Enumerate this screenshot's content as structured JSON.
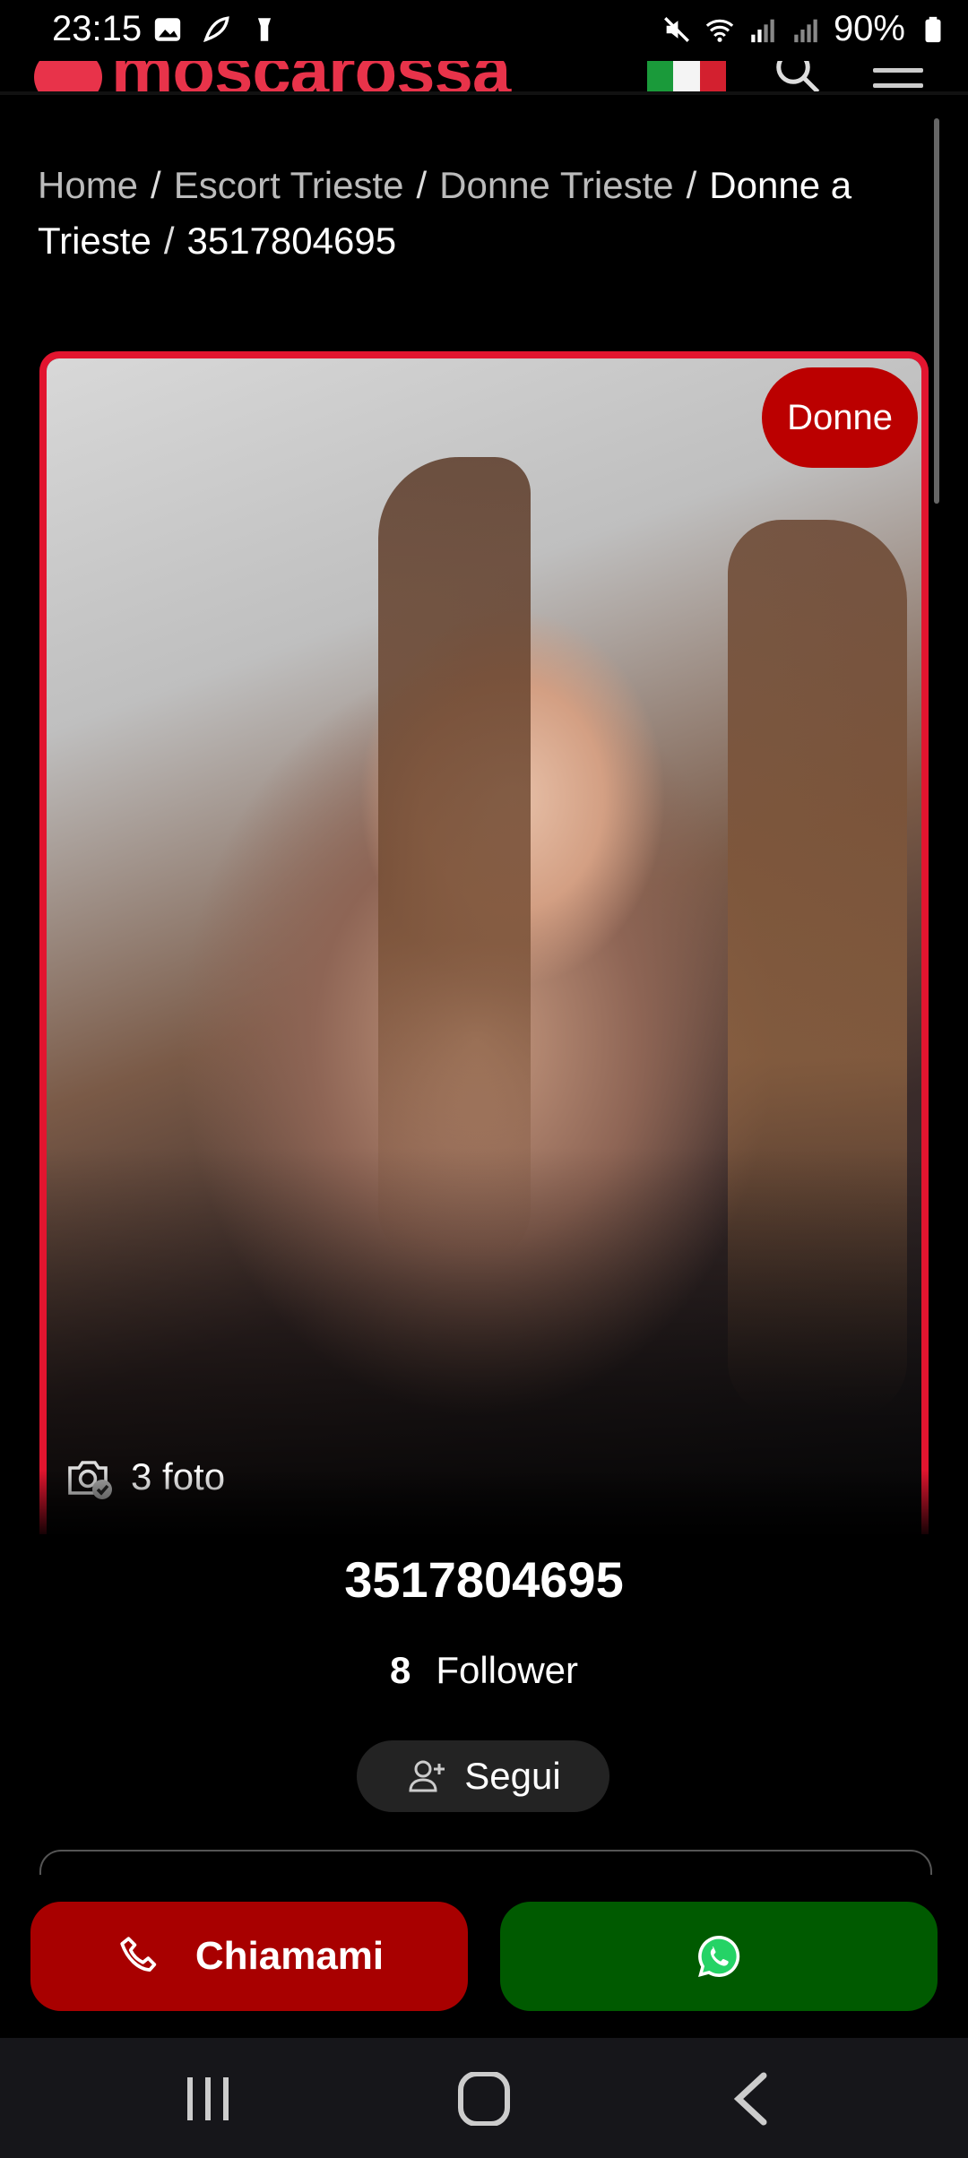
{
  "status_bar": {
    "time": "23:15",
    "battery": "90%"
  },
  "header": {
    "brand": "moscarossa"
  },
  "breadcrumb": {
    "items": [
      "Home",
      "Escort Trieste",
      "Donne Trieste",
      "Donne a Trieste"
    ],
    "current": "3517804695",
    "separator": "/"
  },
  "profile": {
    "category_badge": "Donne",
    "photos_label": "3 foto",
    "name": "3517804695",
    "followers_count": "8",
    "followers_label": "Follower",
    "follow_button": "Segui"
  },
  "actions": {
    "call_label": "Chiamami"
  },
  "colors": {
    "brand_red": "#e8334a",
    "call_red": "#a80000",
    "whatsapp_green": "#005a00",
    "frame_red": "#e2152f"
  }
}
